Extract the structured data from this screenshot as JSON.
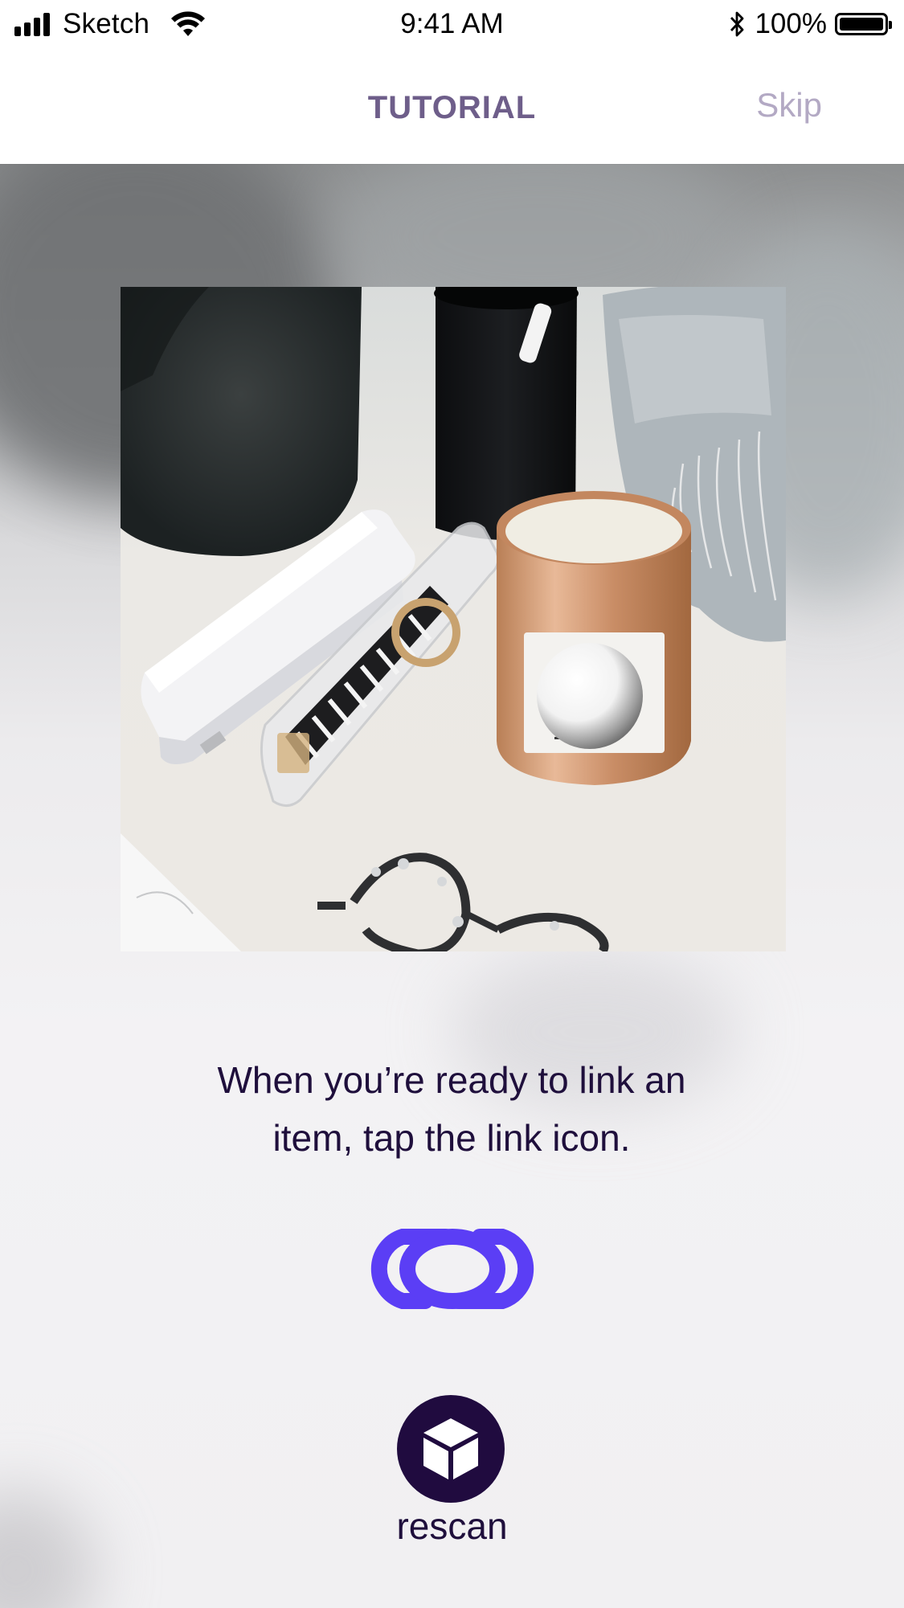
{
  "status_bar": {
    "carrier": "Sketch",
    "time": "9:41 AM",
    "battery_percent": "100%",
    "battery_level": 1.0,
    "icons": [
      "signal-bars-icon",
      "wifi-icon",
      "bluetooth-icon",
      "battery-icon"
    ]
  },
  "nav": {
    "title": "TUTORIAL",
    "skip_label": "Skip"
  },
  "tutorial": {
    "instruction_line1": "When you’re ready to link an",
    "instruction_line2": "item, tap the link icon.",
    "link_icon": "link-chain-icon",
    "rescan_icon": "cube-icon",
    "rescan_label": "rescan"
  },
  "photo": {
    "subject": "desk-scene-photo",
    "overlay": "ar-sphere-marker"
  },
  "colors": {
    "accent_purple": "#5b3ef5",
    "dark_purple": "#200b3f",
    "title_purple": "#6e5e8a",
    "skip_gray": "#b3a9c4",
    "text_dark": "#1f0f3c"
  }
}
